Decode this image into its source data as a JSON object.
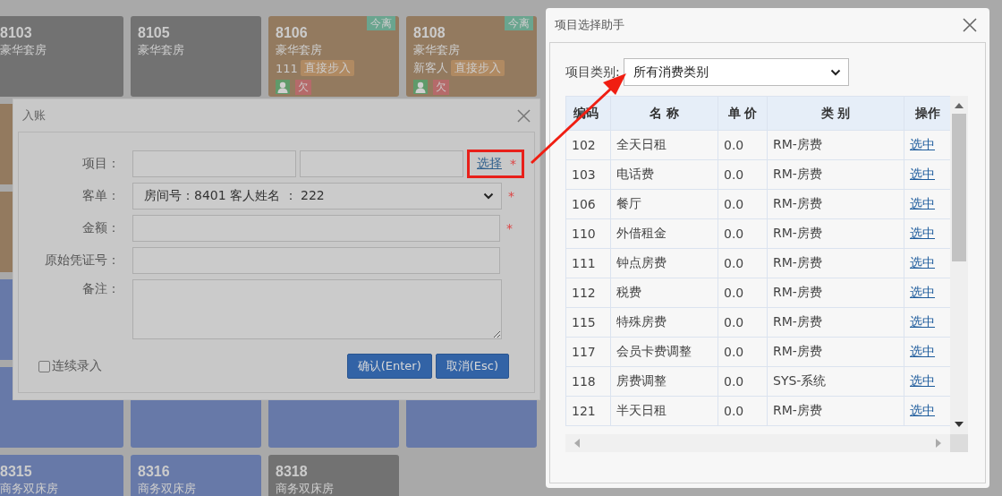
{
  "room_rows": [
    {
      "tiles": [
        {
          "number": "8103",
          "type": "豪华套房",
          "color": "#727272"
        },
        {
          "number": "8105",
          "type": "豪华套房",
          "color": "#727272"
        },
        {
          "number": "8106",
          "type": "豪华套房",
          "color": "#937a5f",
          "depart_tag": "今离",
          "guest": "111",
          "guest_tag": "直接步入",
          "guest_icon": true,
          "owe_badge": "欠"
        },
        {
          "number": "8108",
          "type": "豪华套房",
          "color": "#937a5f",
          "depart_tag": "今离",
          "guest": "新客人",
          "guest_tag": "直接步入",
          "guest_icon": true,
          "owe_badge": "欠"
        }
      ]
    },
    {
      "tiles": [
        {
          "color": "#937a5f"
        }
      ]
    },
    {
      "tiles": [
        {
          "color": "#937a5f"
        }
      ]
    },
    {
      "tiles": [
        {
          "color": "#6779a8"
        }
      ]
    },
    {
      "tiles": [
        {
          "color": "#6779a8"
        },
        {
          "color": "#6779a8"
        },
        {
          "color": "#6779a8"
        },
        {
          "color": "#6779a8"
        }
      ]
    },
    {
      "tiles": [
        {
          "number": "8315",
          "type": "商务双床房",
          "color": "#6779a8"
        },
        {
          "number": "8316",
          "type": "商务双床房",
          "color": "#6779a8"
        },
        {
          "number": "8318",
          "type": "商务双床房",
          "color": "#727272"
        }
      ]
    }
  ],
  "entry_dialog": {
    "title": "入账",
    "fields": [
      {
        "kind": "item",
        "label": "项目：",
        "link": "选择",
        "required_mark": "*"
      },
      {
        "kind": "select",
        "label": "客单：",
        "value": "房间号：8401 客人姓名 ： 222",
        "required_mark": "*"
      },
      {
        "kind": "text",
        "label": "金额：",
        "required_mark": "*"
      },
      {
        "kind": "text",
        "label": "原始凭证号："
      },
      {
        "kind": "textarea",
        "label": "备注："
      }
    ],
    "continuous": {
      "label": "连续录入",
      "checked": false
    },
    "buttons": [
      "确认(Enter)",
      "取消(Esc)"
    ]
  },
  "helper_dialog": {
    "title": "项目选择助手",
    "category_label": "项目类别:",
    "category_value": "所有消费类别",
    "columns": [
      "编码",
      "名 称",
      "单 价",
      "类 别",
      "操作"
    ],
    "rows": [
      {
        "code": "102",
        "name": "全天日租",
        "price": "0.0",
        "category": "RM-房费",
        "action": "选中"
      },
      {
        "code": "103",
        "name": "电话费",
        "price": "0.0",
        "category": "RM-房费",
        "action": "选中"
      },
      {
        "code": "106",
        "name": "餐厅",
        "price": "0.0",
        "category": "RM-房费",
        "action": "选中"
      },
      {
        "code": "110",
        "name": "外借租金",
        "price": "0.0",
        "category": "RM-房费",
        "action": "选中"
      },
      {
        "code": "111",
        "name": "钟点房费",
        "price": "0.0",
        "category": "RM-房费",
        "action": "选中"
      },
      {
        "code": "112",
        "name": "税费",
        "price": "0.0",
        "category": "RM-房费",
        "action": "选中"
      },
      {
        "code": "115",
        "name": "特殊房费",
        "price": "0.0",
        "category": "RM-房费",
        "action": "选中"
      },
      {
        "code": "117",
        "name": "会员卡费调整",
        "price": "0.0",
        "category": "RM-房费",
        "action": "选中"
      },
      {
        "code": "118",
        "name": "房费调整",
        "price": "0.0",
        "category": "SYS-系统",
        "action": "选中"
      },
      {
        "code": "121",
        "name": "半天日租",
        "price": "0.0",
        "category": "RM-房费",
        "action": "选中"
      }
    ]
  }
}
